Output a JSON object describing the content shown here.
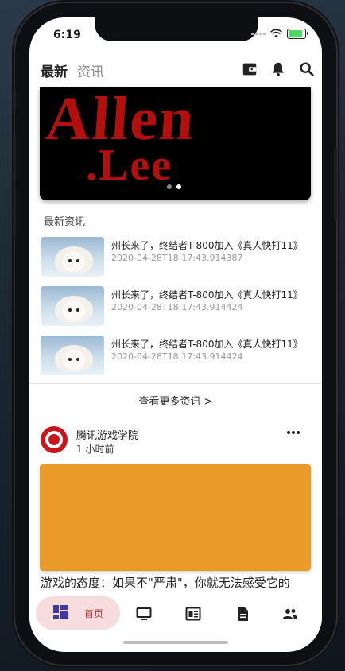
{
  "status_bar": {
    "time": "6:19",
    "battery_level": 0.85,
    "battery_color": "#4cd964"
  },
  "header": {
    "tabs": [
      {
        "label": "最新",
        "active": true
      },
      {
        "label": "资讯",
        "active": false
      }
    ],
    "icons": [
      "wallet-icon",
      "bell-icon",
      "search-icon"
    ]
  },
  "banner": {
    "line1": "Allen",
    "line2": ".Lee",
    "text_color": "#b40f0f",
    "pages": 2,
    "current_page": 2
  },
  "news_section": {
    "title": "最新资讯",
    "items": [
      {
        "title": "州长来了，终结者T-800加入《真人快打11》",
        "time": "2020-04-28T18:17:43.914387",
        "thumbnail": "baby-seal"
      },
      {
        "title": "州长来了，终结者T-800加入《真人快打11》",
        "time": "2020-04-28T18:17:43.914424",
        "thumbnail": "baby-seal"
      },
      {
        "title": "州长来了，终结者T-800加入《真人快打11》",
        "time": "2020-04-28T18:17:43.914424",
        "thumbnail": "baby-seal"
      }
    ],
    "more_label": "查看更多资讯 >"
  },
  "post": {
    "author": "腾讯游戏学院",
    "time": "1 小时前",
    "image_color": "#e99a29",
    "text": "游戏的态度：如果不\"严肃\"，你就无法感受它的"
  },
  "bottom_nav": {
    "items": [
      {
        "label": "首页",
        "icon": "dashboard-icon",
        "active": true
      },
      {
        "label": "",
        "icon": "tv-icon",
        "active": false
      },
      {
        "label": "",
        "icon": "news-icon",
        "active": false
      },
      {
        "label": "",
        "icon": "document-icon",
        "active": false
      },
      {
        "label": "",
        "icon": "people-icon",
        "active": false
      }
    ],
    "active_color": "#b03a3a",
    "active_bg": "#f6dcdc"
  }
}
